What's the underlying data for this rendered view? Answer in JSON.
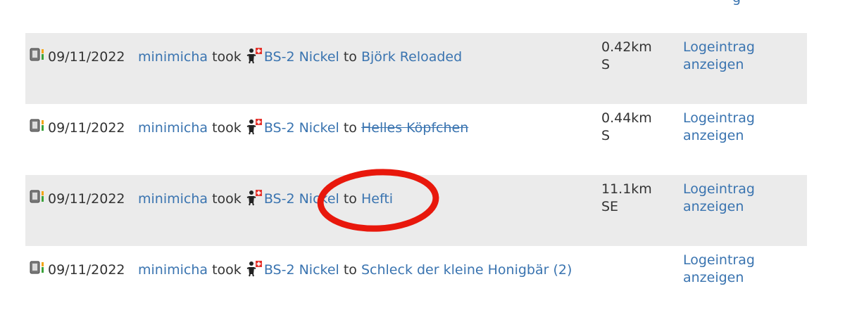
{
  "header": {
    "partial_link": "g"
  },
  "log": {
    "rows": [
      {
        "date": "09/11/2022",
        "user": "minimicha",
        "verb": "took",
        "trackable": "BS-2 Nickel",
        "prep": "to",
        "target": "Björk Reloaded",
        "target_archived": false,
        "distance": "0.42km",
        "direction": "S",
        "action_line1": "Logeintrag",
        "action_line2": "anzeigen"
      },
      {
        "date": "09/11/2022",
        "user": "minimicha",
        "verb": "took",
        "trackable": "BS-2 Nickel",
        "prep": "to",
        "target": "Helles Köpfchen",
        "target_archived": true,
        "distance": "0.44km",
        "direction": "S",
        "action_line1": "Logeintrag",
        "action_line2": "anzeigen"
      },
      {
        "date": "09/11/2022",
        "user": "minimicha",
        "verb": "took",
        "trackable": "BS-2 Nickel",
        "prep": "to",
        "target": "Hefti",
        "target_archived": false,
        "distance": "11.1km",
        "direction": "SE",
        "action_line1": "Logeintrag",
        "action_line2": "anzeigen"
      },
      {
        "date": "09/11/2022",
        "user": "minimicha",
        "verb": "took",
        "trackable": "BS-2 Nickel",
        "prep": "to",
        "target": "Schleck der kleine Honigbär (2)",
        "target_archived": false,
        "distance": "",
        "direction": "",
        "action_line1": "Logeintrag",
        "action_line2": "anzeigen"
      }
    ]
  },
  "icons": {
    "log_type": "retrieved-log-icon",
    "trackable": "travel-bug-icon"
  },
  "colors": {
    "link": "#3a74b0",
    "row_shade": "#ebebeb",
    "annotation": "#e8180c",
    "text": "#333333"
  }
}
